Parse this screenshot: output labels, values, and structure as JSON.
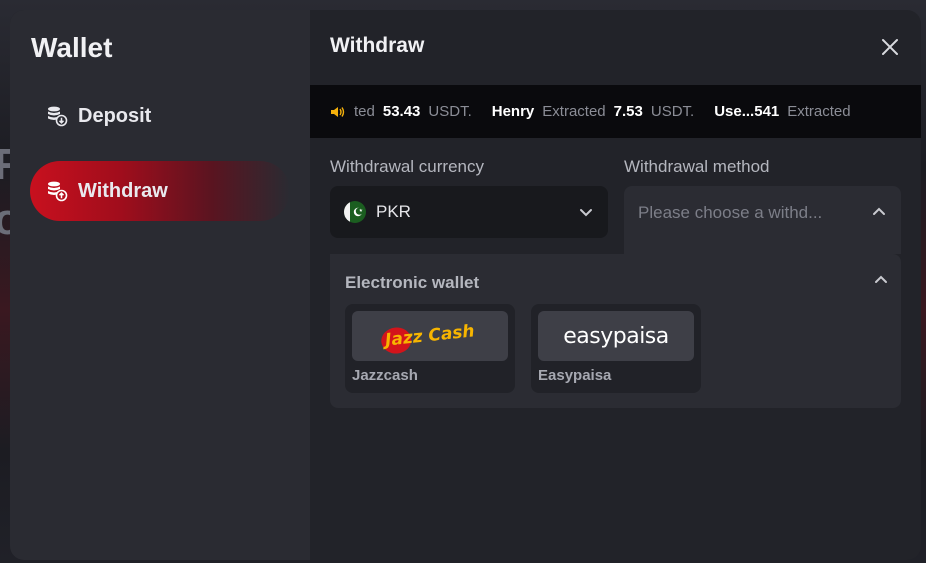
{
  "sidebar": {
    "title": "Wallet",
    "items": [
      {
        "label": "Deposit",
        "icon": "coins-deposit-icon",
        "active": false
      },
      {
        "label": "Withdraw",
        "icon": "coins-withdraw-icon",
        "active": true
      }
    ]
  },
  "main": {
    "title": "Withdraw",
    "close_icon": "close-icon",
    "ticker": {
      "icon": "speaker-icon",
      "entries": [
        {
          "user": "",
          "action": "ted",
          "amount": "53.43",
          "currency": "USDT."
        },
        {
          "user": "Henry",
          "action": "Extracted",
          "amount": "7.53",
          "currency": "USDT."
        },
        {
          "user": "Use...541",
          "action": "Extracted",
          "amount": "",
          "currency": ""
        }
      ]
    },
    "currency": {
      "label": "Withdrawal currency",
      "value": "PKR",
      "flag": "pakistan-flag-icon"
    },
    "method": {
      "label": "Withdrawal method",
      "placeholder": "Please choose a withd..."
    },
    "electronic_wallet": {
      "title": "Electronic wallet",
      "options": [
        {
          "name": "Jazzcash",
          "logo_text": "Jazz Cash"
        },
        {
          "name": "Easypaisa",
          "logo_text": "easypaisa"
        }
      ]
    }
  },
  "colors": {
    "accent": "#c8101e",
    "modal_bg": "#222329",
    "sidebar_bg": "#2a2b32",
    "ticker_bg": "#0a0a0d"
  }
}
